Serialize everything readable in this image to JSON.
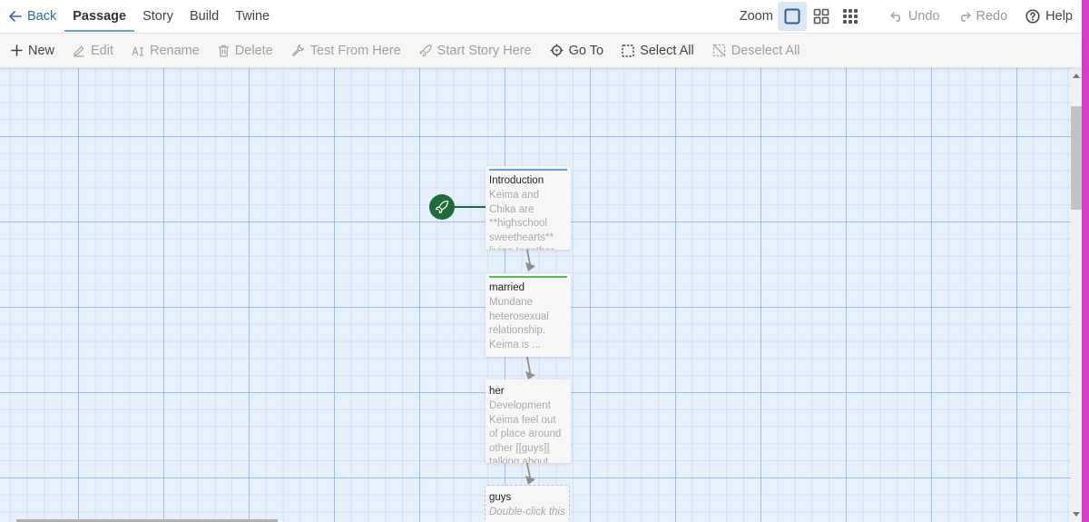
{
  "topbar": {
    "back_label": "Back",
    "tabs": [
      {
        "label": "Passage",
        "active": true
      },
      {
        "label": "Story"
      },
      {
        "label": "Build"
      },
      {
        "label": "Twine"
      }
    ],
    "zoom_label": "Zoom",
    "undo_label": "Undo",
    "redo_label": "Redo",
    "help_label": "Help"
  },
  "toolbar": {
    "new_label": "New",
    "edit_label": "Edit",
    "rename_label": "Rename",
    "delete_label": "Delete",
    "test_label": "Test From Here",
    "start_label": "Start Story Here",
    "goto_label": "Go To",
    "select_all_label": "Select All",
    "deselect_all_label": "Deselect All"
  },
  "passages": [
    {
      "name": "Introduction",
      "excerpt": "Keima and Chika are **highschool sweethearts** living together ...",
      "tag_color": "#6aa3d9"
    },
    {
      "name": "married",
      "excerpt": "Mundane heterosexual relationship. Keima is ...",
      "tag_color": "#5cb85c"
    },
    {
      "name": "her",
      "excerpt": "Development Keima feel out of place around other [[guys]] talking about ..."
    },
    {
      "name": "guys",
      "excerpt": "Double-click this"
    }
  ],
  "colors": {
    "accent": "#2c6cb0",
    "start_icon_bg": "#1f6b38",
    "grid_bg": "#e6f0fc"
  }
}
